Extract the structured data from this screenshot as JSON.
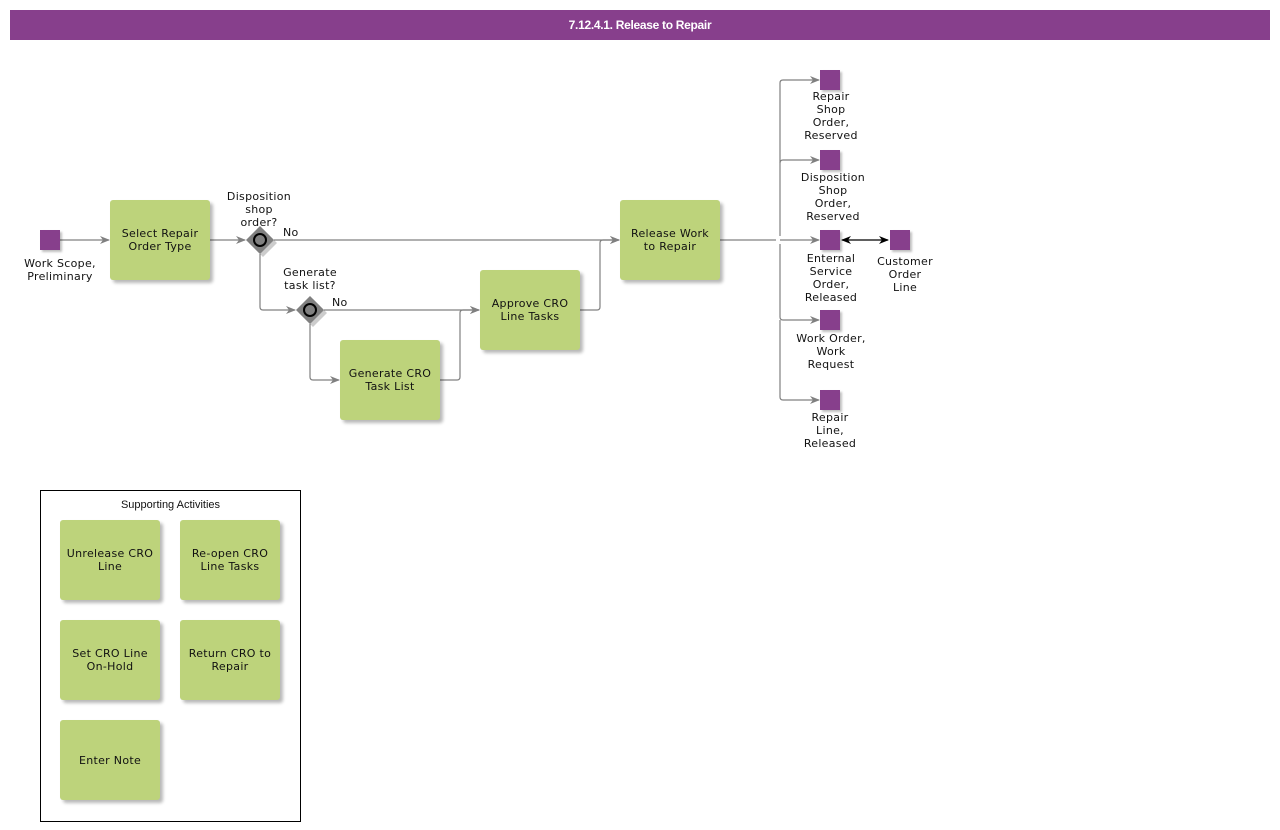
{
  "header": {
    "title": "7.12.4.1. Release to Repair"
  },
  "colors": {
    "header_bg": "#873f8c",
    "task_fill": "#bdd37b",
    "data_object": "#873f8c",
    "connector": "#808080",
    "gateway": "#808080"
  },
  "start": {
    "label": "Work Scope,\nPreliminary"
  },
  "tasks": {
    "select_repair_order_type": "Select Repair Order Type",
    "generate_cro_task_list": "Generate CRO Task List",
    "approve_cro_line_tasks": "Approve CRO Line Tasks",
    "release_work_to_repair": "Release Work to Repair"
  },
  "gateways": {
    "disposition_shop_order": {
      "question": "Disposition\nshop\norder?",
      "no_label": "No"
    },
    "generate_task_list": {
      "question": "Generate\ntask list?",
      "no_label": "No"
    }
  },
  "outputs": [
    {
      "label": "Repair\nShop\nOrder,\nReserved"
    },
    {
      "label": "Disposition\nShop\nOrder,\nReserved"
    },
    {
      "label": "Enternal\nService\nOrder,\nReleased"
    },
    {
      "label": "Work Order,\nWork\nRequest"
    },
    {
      "label": "Repair\nLine,\nReleased"
    }
  ],
  "linked": {
    "label": "Customer\nOrder\nLine"
  },
  "supporting": {
    "title": "Supporting Activities",
    "items": [
      "Unrelease CRO Line",
      "Re-open CRO Line Tasks",
      "Set CRO Line On-Hold",
      "Return CRO to Repair",
      "Enter Note"
    ]
  }
}
